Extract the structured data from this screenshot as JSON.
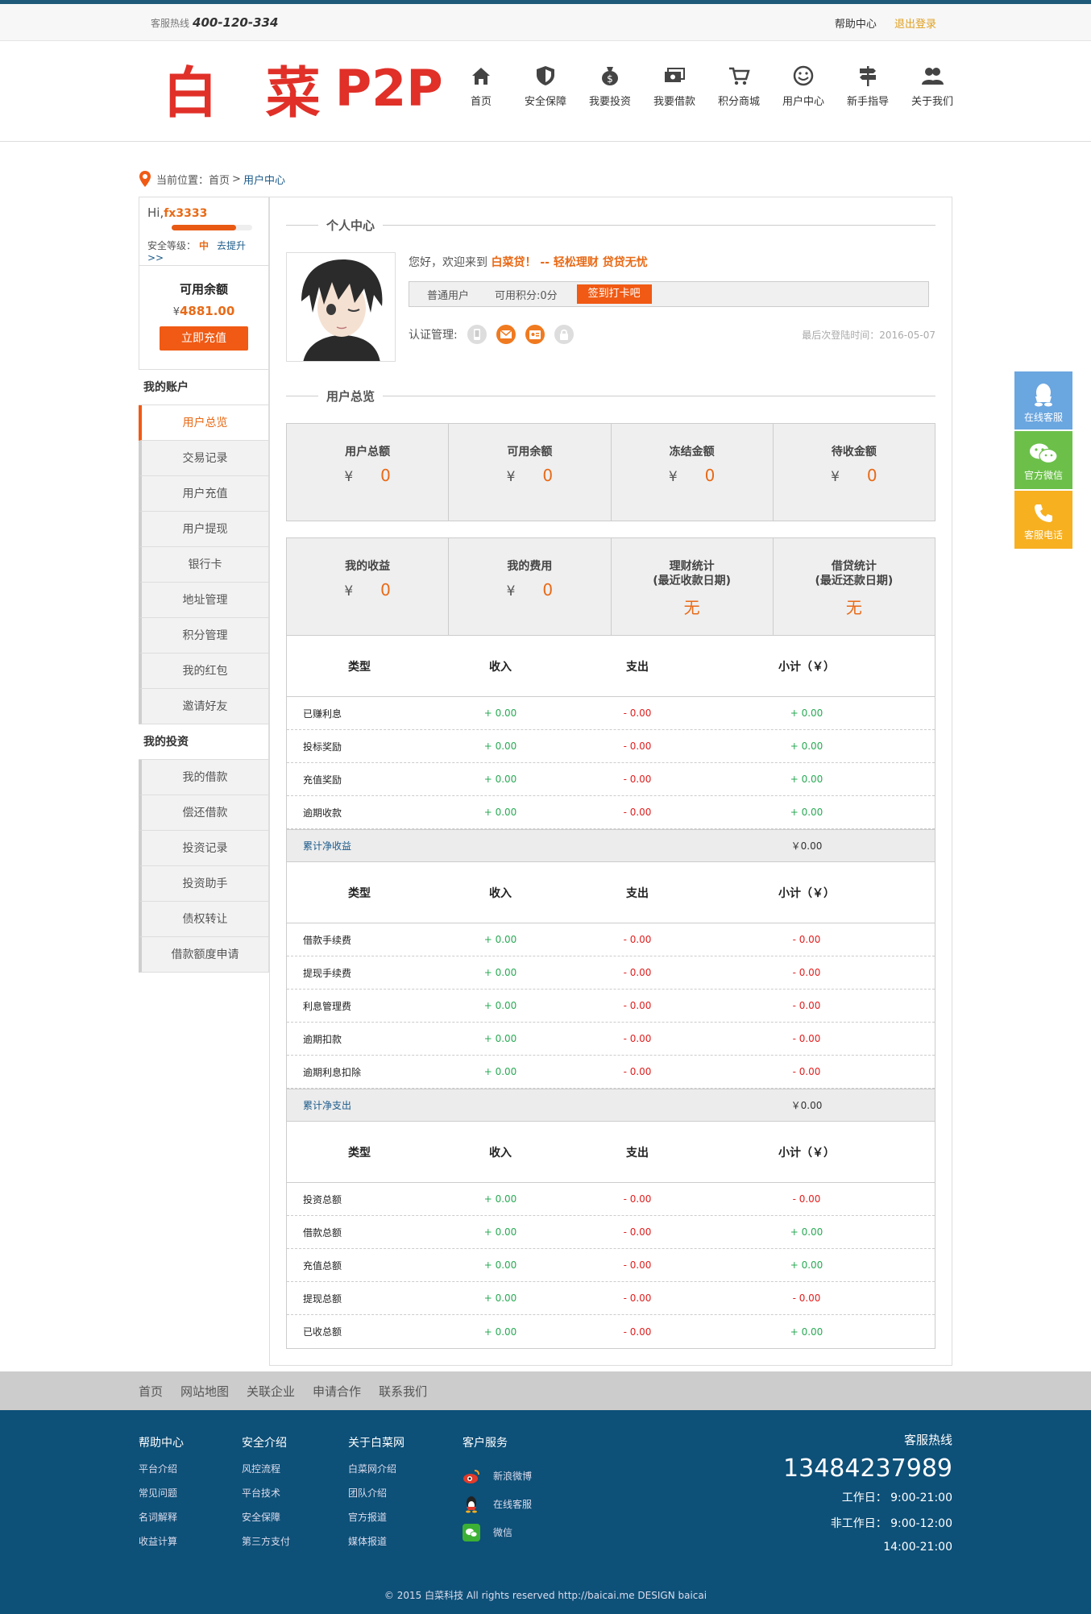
{
  "topbar": {
    "hotline_label": "客服热线",
    "hotline_number": "400-120-334",
    "help": "帮助中心",
    "logout": "退出登录"
  },
  "logo": {
    "text_cn": "白 菜",
    "text_en": "P2P"
  },
  "nav": [
    "首页",
    "安全保障",
    "我要投资",
    "我要借款",
    "积分商城",
    "用户中心",
    "新手指导",
    "关于我们"
  ],
  "breadcrumb": {
    "label": "当前位置：",
    "home": "首页",
    "sep": ">",
    "current": "用户中心"
  },
  "user": {
    "greeting": "Hi,",
    "username": "fx3333",
    "security_label": "安全等级：",
    "security_level": "中",
    "security_level_fill": 0.8,
    "upgrade": "去提升>>"
  },
  "balance": {
    "title": "可用余额",
    "currency": "¥",
    "amount": "4881.00",
    "recharge": "立即充值"
  },
  "sidebar": {
    "account_title": "我的账户",
    "account_items": [
      "用户总览",
      "交易记录",
      "用户充值",
      "用户提现",
      "银行卡",
      "地址管理",
      "积分管理",
      "我的红包",
      "邀请好友"
    ],
    "invest_title": "我的投资",
    "invest_items": [
      "我的借款",
      "偿还借款",
      "投资记录",
      "投资助手",
      "债权转让",
      "借款额度申请"
    ]
  },
  "profile": {
    "section_title": "个人中心",
    "welcome_prefix": "您好，欢迎来到",
    "welcome_brand": "白菜贷！ -- 轻松理财 贷贷无忧",
    "user_type": "普通用户",
    "points": "可用积分:0分",
    "sign_button": "签到打卡吧",
    "cert_label": "认证管理:",
    "last_login": "最后次登陆时间：2016-05-07"
  },
  "overview": {
    "section_title": "用户总览",
    "row1": [
      {
        "label": "用户总额",
        "value": "0"
      },
      {
        "label": "可用余额",
        "value": "0"
      },
      {
        "label": "冻结金额",
        "value": "0"
      },
      {
        "label": "待收金额",
        "value": "0"
      }
    ],
    "row2": [
      {
        "label": "我的收益",
        "value": "0"
      },
      {
        "label": "我的费用",
        "value": "0"
      }
    ],
    "row2_stats": [
      {
        "label1": "理财统计",
        "label2": "(最近收款日期)",
        "value": "无"
      },
      {
        "label1": "借贷统计",
        "label2": "(最近还款日期)",
        "value": "无"
      }
    ],
    "currency": "¥"
  },
  "tables": {
    "headers": [
      "类型",
      "收入",
      "支出",
      "小计（￥）"
    ],
    "table1": {
      "rows": [
        [
          "已赚利息",
          "+ 0.00",
          "- 0.00",
          "+ 0.00"
        ],
        [
          "投标奖励",
          "+ 0.00",
          "- 0.00",
          "+ 0.00"
        ],
        [
          "充值奖励",
          "+ 0.00",
          "- 0.00",
          "+ 0.00"
        ],
        [
          "逾期收款",
          "+ 0.00",
          "- 0.00",
          "+ 0.00"
        ]
      ],
      "sum_label": "累计净收益",
      "sum_value": "￥0.00"
    },
    "table2": {
      "rows": [
        [
          "借款手续费",
          "+ 0.00",
          "- 0.00",
          "- 0.00"
        ],
        [
          "提现手续费",
          "+ 0.00",
          "- 0.00",
          "- 0.00"
        ],
        [
          "利息管理费",
          "+ 0.00",
          "- 0.00",
          "- 0.00"
        ],
        [
          "逾期扣款",
          "+ 0.00",
          "- 0.00",
          "- 0.00"
        ],
        [
          "逾期利息扣除",
          "+ 0.00",
          "- 0.00",
          "- 0.00"
        ]
      ],
      "sum_label": "累计净支出",
      "sum_value": "￥0.00"
    },
    "table3": {
      "rows": [
        [
          "投资总额",
          "+ 0.00",
          "- 0.00",
          "- 0.00"
        ],
        [
          "借款总额",
          "+ 0.00",
          "- 0.00",
          "+ 0.00"
        ],
        [
          "充值总额",
          "+ 0.00",
          "- 0.00",
          "+ 0.00"
        ],
        [
          "提现总额",
          "+ 0.00",
          "- 0.00",
          "- 0.00"
        ],
        [
          "已收总额",
          "+ 0.00",
          "- 0.00",
          "+ 0.00"
        ]
      ]
    }
  },
  "footer_nav": [
    "首页",
    "网站地图",
    "关联企业",
    "申请合作",
    "联系我们"
  ],
  "footer": {
    "cols": [
      {
        "title": "帮助中心",
        "items": [
          "平台介绍",
          "常见问题",
          "名词解释",
          "收益计算"
        ]
      },
      {
        "title": "安全介绍",
        "items": [
          "风控流程",
          "平台技术",
          "安全保障",
          "第三方支付"
        ]
      },
      {
        "title": "关于白菜网",
        "items": [
          "白菜网介绍",
          "团队介绍",
          "官方报道",
          "媒体报道"
        ]
      }
    ],
    "service": {
      "title": "客户服务",
      "items": [
        "新浪微博",
        "在线客服",
        "微信"
      ]
    },
    "hotline_title": "客服热线",
    "hotline": "13484237989",
    "workday": "工作日： 9:00-21:00",
    "weekend": "非工作日： 9:00-12:00",
    "weekend2": "14:00-21:00",
    "copyright": "© 2015 白菜科技 All rights reserved http://baicai.me DESIGN baicai"
  },
  "float": [
    "在线客服",
    "官方微信",
    "客服电话"
  ],
  "colors": {
    "accent": "#f05a14",
    "footer_bg": "#0d5078",
    "positive": "#2aaa55",
    "negative": "#e02020",
    "float_qq": "#6aa6e0",
    "float_wechat": "#6cc04a",
    "float_phone": "#f7b020"
  }
}
